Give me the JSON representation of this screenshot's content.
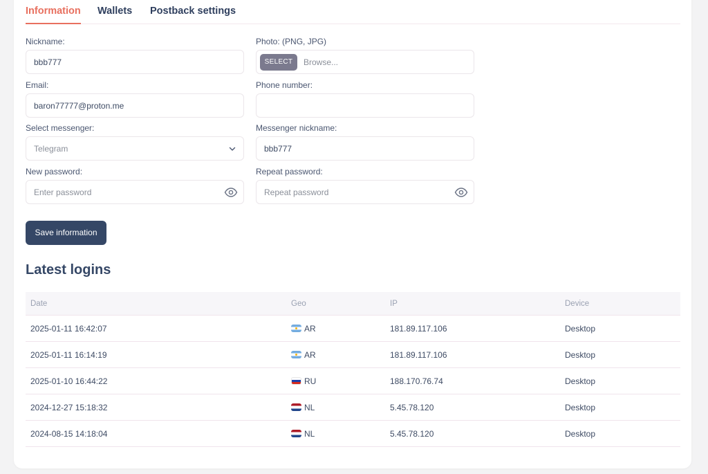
{
  "tabs": [
    {
      "label": "Information",
      "active": true
    },
    {
      "label": "Wallets",
      "active": false
    },
    {
      "label": "Postback settings",
      "active": false
    }
  ],
  "form": {
    "nickname": {
      "label": "Nickname:",
      "value": "bbb777"
    },
    "photo": {
      "label": "Photo: (PNG, JPG)",
      "button": "SELECT",
      "placeholder": "Browse..."
    },
    "email": {
      "label": "Email:",
      "value": "baron77777@proton.me"
    },
    "phone": {
      "label": "Phone number:",
      "value": ""
    },
    "messenger": {
      "label": "Select messenger:",
      "selected": "Telegram"
    },
    "messenger_nickname": {
      "label": "Messenger nickname:",
      "value": "bbb777"
    },
    "new_password": {
      "label": "New password:",
      "placeholder": "Enter password"
    },
    "repeat_password": {
      "label": "Repeat password:",
      "placeholder": "Repeat password"
    },
    "save_label": "Save information"
  },
  "logins": {
    "title": "Latest logins",
    "columns": [
      "Date",
      "Geo",
      "IP",
      "Device"
    ],
    "rows": [
      {
        "date": "2025-01-11 16:42:07",
        "flag": "ar",
        "geo": "AR",
        "ip": "181.89.117.106",
        "device": "Desktop"
      },
      {
        "date": "2025-01-11 16:14:19",
        "flag": "ar",
        "geo": "AR",
        "ip": "181.89.117.106",
        "device": "Desktop"
      },
      {
        "date": "2025-01-10 16:44:22",
        "flag": "ru",
        "geo": "RU",
        "ip": "188.170.76.74",
        "device": "Desktop"
      },
      {
        "date": "2024-12-27 15:18:32",
        "flag": "nl",
        "geo": "NL",
        "ip": "5.45.78.120",
        "device": "Desktop"
      },
      {
        "date": "2024-08-15 14:18:04",
        "flag": "nl",
        "geo": "NL",
        "ip": "5.45.78.120",
        "device": "Desktop"
      }
    ]
  },
  "colors": {
    "accent": "#e8705f",
    "primary": "#354766",
    "select_button": "#7b7a8e"
  }
}
